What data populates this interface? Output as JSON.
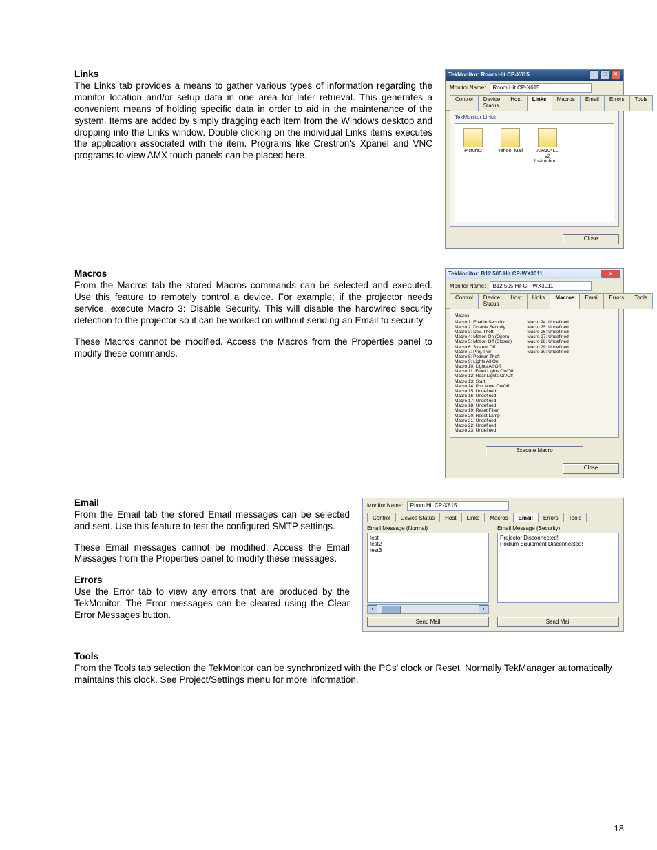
{
  "page_number": "18",
  "sections": {
    "links": {
      "title": "Links",
      "p1": "The Links tab provides a means to gather various types of information regarding the monitor location and/or setup data in one area for later retrieval. This generates a convenient means of holding specific data in order to aid in the maintenance of the system. Items are added by simply dragging each item from the Windows desktop and dropping into the Links window. Double clicking on the individual Links items executes the application associated with the item. Programs like Crestron's Xpanel and VNC programs to view AMX touch panels can be placed here."
    },
    "macros": {
      "title": "Macros",
      "p1": "From the Macros tab the stored Macros commands can be selected and executed. Use this feature to remotely control a device. For example; if the projector needs service, execute Macro 3: Disable Security. This will disable the hardwired security detection to the projector so it can be worked on without sending an Email to security.",
      "p2": "These Macros cannot be modified. Access the Macros from the Properties panel to modify these commands."
    },
    "email": {
      "title": "Email",
      "p1": "From the Email tab the stored Email messages can be selected and sent. Use this feature to test the configured SMTP settings.",
      "p2": "These Email messages cannot be modified. Access the Email Messages from the Properties panel to modify these messages."
    },
    "errors": {
      "title": "Errors",
      "p1": "Use the Error tab to view any errors that are produced by the TekMonitor. The Error messages can be cleared using the Clear Error Messages button."
    },
    "tools": {
      "title": "Tools",
      "p1": "From the Tools tab selection the TekMonitor can be synchronized with the PCs' clock or Reset. Normally TekManager automatically maintains this clock. See Project/Settings menu for more information."
    }
  },
  "shots": {
    "links_win": {
      "titlebar": "TekMonitor: Room Hit CP-X615",
      "monitor_name_label": "Monitor Name:",
      "monitor_name_value": "Room Hit CP-X615",
      "tabs": [
        "Control",
        "Device Status",
        "Host",
        "Links",
        "Macros",
        "Email",
        "Errors",
        "Tools"
      ],
      "active_tab": 3,
      "links_header": "TekMonitor Links",
      "items": [
        "Picture2",
        "Yahoo! Mail",
        "AIR104LL v2 Instruction..."
      ],
      "close_btn": "Close"
    },
    "macros_win": {
      "titlebar": "TekMonitor: B12 505 Hit CP-WX3011",
      "monitor_name_label": "Monitor Name:",
      "monitor_name_value": "B12 505 Hit CP-WX3011",
      "tabs": [
        "Control",
        "Device Status",
        "Host",
        "Links",
        "Macros",
        "Email",
        "Errors",
        "Tools"
      ],
      "active_tab": 4,
      "group_label": "Macros",
      "left": [
        "Macro 1: Enable Security",
        "Macro 2: Disable Security",
        "Macro 3: Dev. Theft",
        "Macro 4: Motion On (Open)",
        "Macro 5: Motion Off (Closed)",
        "Macro 6: System Off",
        "Macro 7: Proj. Pwr",
        "Macro 8: Podium Theft",
        "Macro 9: Lights All On",
        "Macro 10: Lights All Off",
        "Macro 11: Front Lights On/Off",
        "Macro 12: Rear Lights On/Off",
        "Macro 13: Start",
        "Macro 14: Proj Mute On/Off",
        "Macro 15: Undefined",
        "Macro 16: Undefined",
        "Macro 17: Undefined",
        "Macro 18: Undefined",
        "Macro 19: Reset Filter",
        "Macro 20: Reset Lamp",
        "Macro 21: Undefined",
        "Macro 22: Undefined",
        "Macro 23: Undefined"
      ],
      "right": [
        "Macro 24: Undefined",
        "Macro 25: Undefined",
        "Macro 26: Undefined",
        "Macro 27: Undefined",
        "Macro 28: Undefined",
        "Macro 29: Undefined",
        "Macro 30: Undefined"
      ],
      "execute_btn": "Execute Macro",
      "close_btn": "Close"
    },
    "email_win": {
      "monitor_name_label": "Monitor Name:",
      "monitor_name_value": "Room Hit CP-X615",
      "tabs": [
        "Control",
        "Device Status",
        "Host",
        "Links",
        "Macros",
        "Email",
        "Errors",
        "Tools"
      ],
      "active_tab": 5,
      "left_header": "Email Message (Normal)",
      "left_items": [
        "test",
        "test2",
        "test3"
      ],
      "right_header": "Email Message (Security)",
      "right_items": [
        "Projector Disconnected!",
        "Podium Equipment Disconnected!"
      ],
      "send_btn": "Send Mail"
    }
  }
}
